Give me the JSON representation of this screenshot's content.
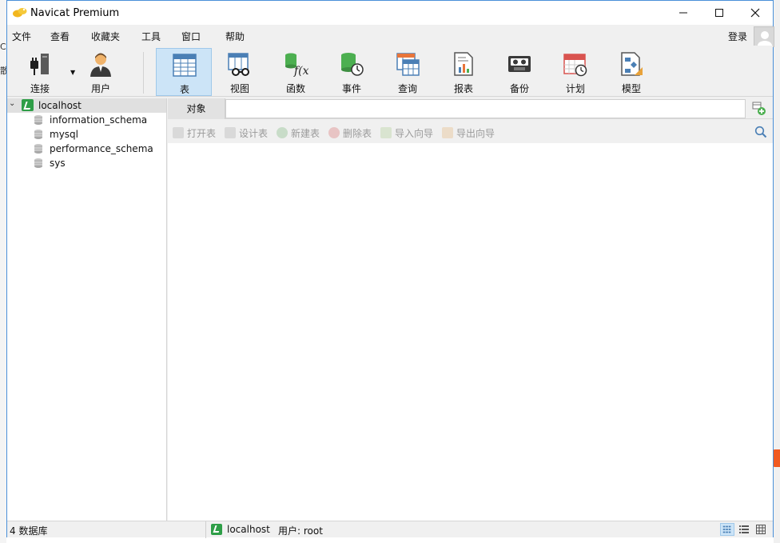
{
  "app": {
    "title": "Navicat Premium"
  },
  "desktop": {
    "left_text_1": "C",
    "left_text_2": "散"
  },
  "menu": [
    "文件",
    "查看",
    "收藏夹",
    "工具",
    "窗口",
    "帮助"
  ],
  "login_label": "登录",
  "toolbar": {
    "connect": "连接",
    "user": "用户",
    "table": "表",
    "view": "视图",
    "function": "函数",
    "event": "事件",
    "query": "查询",
    "report": "报表",
    "backup": "备份",
    "schedule": "计划",
    "model": "模型"
  },
  "tree": {
    "connection": "localhost",
    "databases": [
      "information_schema",
      "mysql",
      "performance_schema",
      "sys"
    ]
  },
  "objects": {
    "tab_label": "对象",
    "actions": {
      "open": "打开表",
      "design": "设计表",
      "new": "新建表",
      "delete": "删除表",
      "import": "导入向导",
      "export": "导出向导"
    }
  },
  "status": {
    "db_count": "4 数据库",
    "connection": "localhost",
    "user": "用户: root"
  },
  "colors": {
    "accent_blue": "#cce4f7",
    "connection_green": "#2e9e47",
    "database_grey": "#b9b9b9"
  }
}
